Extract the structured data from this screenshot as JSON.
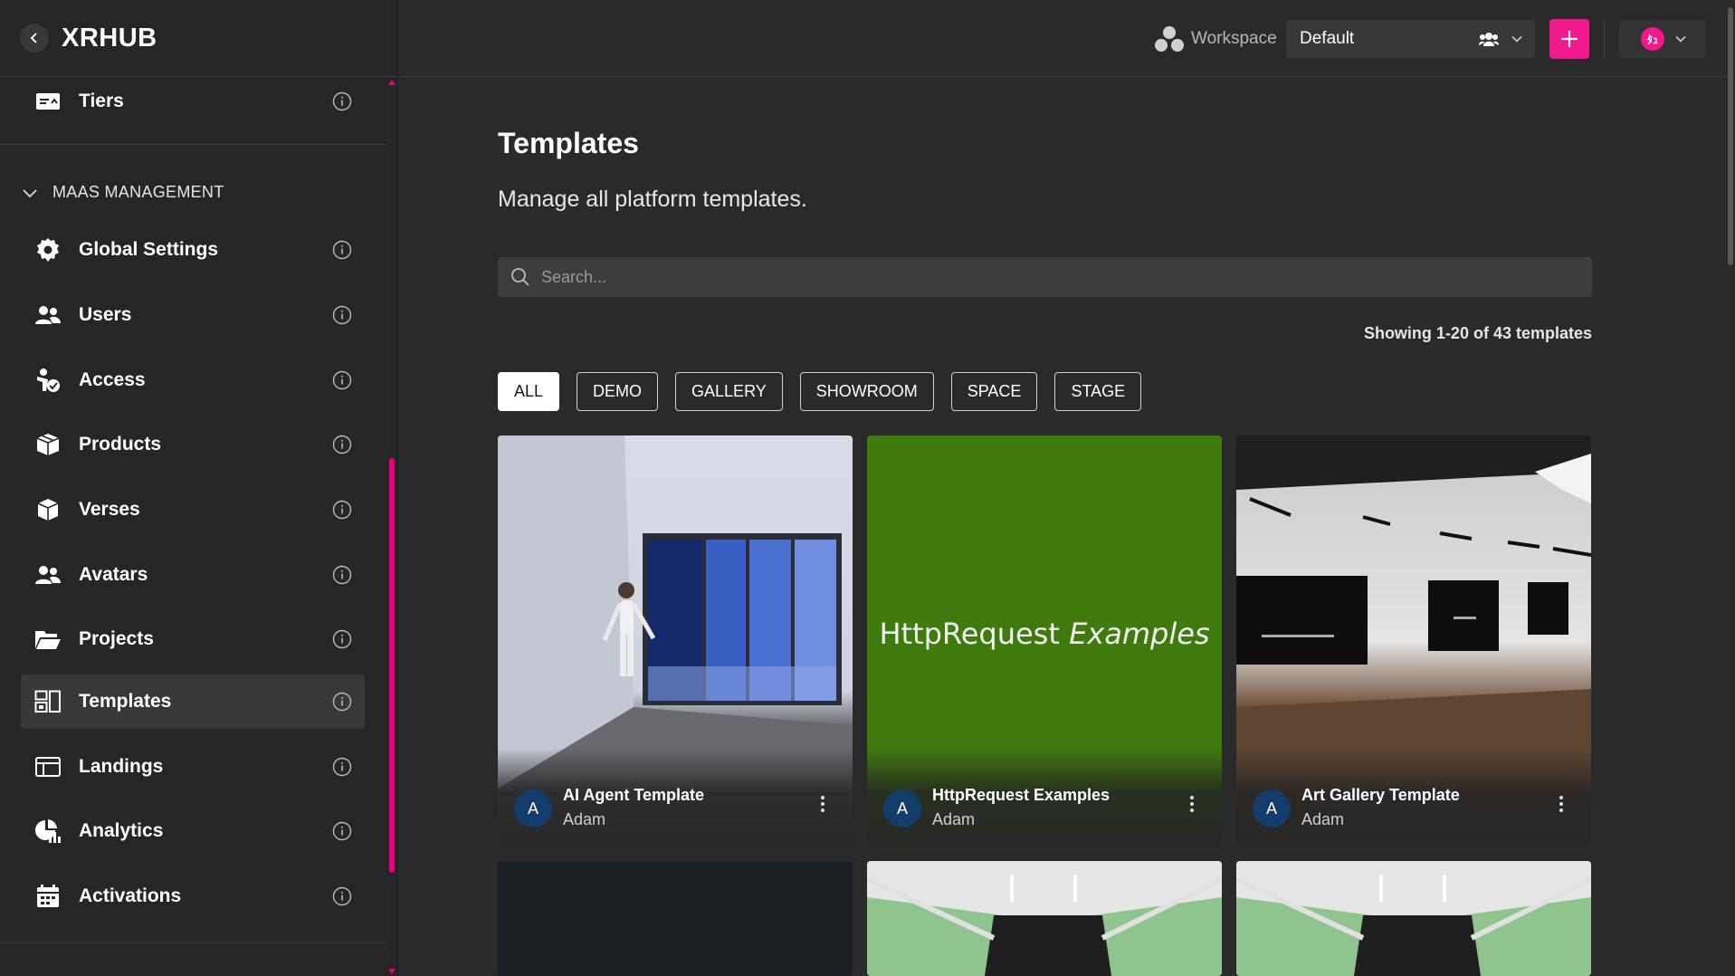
{
  "app": {
    "logo": "XRHUB"
  },
  "sidebar": {
    "top_item": {
      "label": "Tiers"
    },
    "section_label": "MAAS MANAGEMENT",
    "items": [
      {
        "label": "Global Settings",
        "icon": "gear-icon"
      },
      {
        "label": "Users",
        "icon": "users-icon"
      },
      {
        "label": "Access",
        "icon": "access-icon"
      },
      {
        "label": "Products",
        "icon": "boxes-icon"
      },
      {
        "label": "Verses",
        "icon": "cube-icon"
      },
      {
        "label": "Avatars",
        "icon": "avatars-icon"
      },
      {
        "label": "Projects",
        "icon": "folder-icon"
      },
      {
        "label": "Templates",
        "icon": "templates-icon",
        "active": true
      },
      {
        "label": "Landings",
        "icon": "landings-icon"
      },
      {
        "label": "Analytics",
        "icon": "analytics-icon"
      },
      {
        "label": "Activations",
        "icon": "activations-icon"
      }
    ]
  },
  "topbar": {
    "workspace_label": "Workspace",
    "workspace_value": "Default",
    "user_initials": "ﾀｭ"
  },
  "main": {
    "title": "Templates",
    "subtitle": "Manage all platform templates.",
    "search_placeholder": "Search...",
    "showing": "Showing 1-20 of 43 templates",
    "filters": [
      "ALL",
      "DEMO",
      "GALLERY",
      "SHOWROOM",
      "SPACE",
      "STAGE"
    ],
    "active_filter": "ALL",
    "cards": [
      {
        "title": "AI Agent Template",
        "author": "Adam",
        "avatar": "A"
      },
      {
        "title": "HttpRequest Examples",
        "author": "Adam",
        "avatar": "A",
        "thumb_text_a": "HttpRequest",
        "thumb_text_b": "Examples"
      },
      {
        "title": "Art Gallery Template",
        "author": "Adam",
        "avatar": "A"
      }
    ]
  },
  "colors": {
    "accent": "#f0198e",
    "background": "#2a2a2a",
    "sidebar": "#262626"
  }
}
